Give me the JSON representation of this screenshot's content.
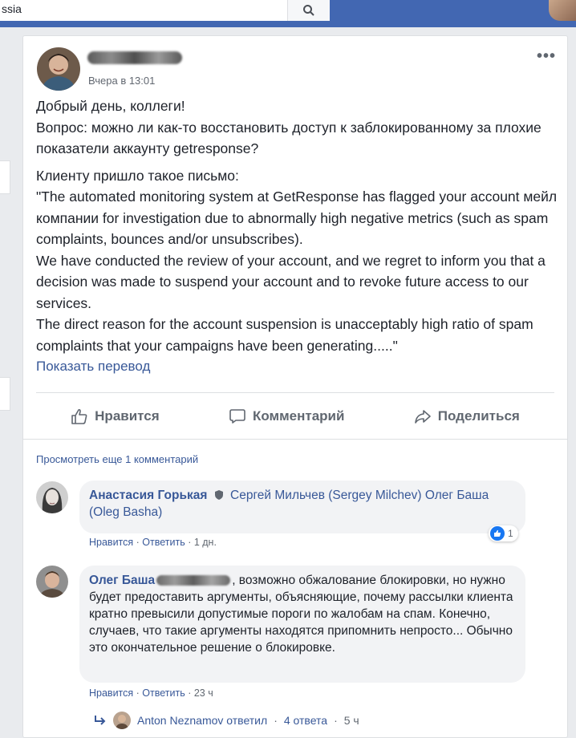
{
  "topbar": {
    "search_value": "ssia",
    "search_icon": "search-icon",
    "brand_color": "#4267b2"
  },
  "post": {
    "time": "Вчера в 13:01",
    "lines": [
      "Добрый день, коллеги!",
      "Вопрос: можно ли как-то восстановить доступ к заблокированному за плохие показатели аккаунту getresponse?"
    ],
    "paragraph2": [
      "Клиенту пришло такое письмо:",
      "\"The automated monitoring system at GetResponse has flagged your account мейл компании for investigation due to abnormally high negative metrics (such as spam complaints, bounces and/or unsubscribes).",
      "We have conducted the review of your account, and we regret to inform you that a decision was made to suspend your account and to revoke future access to our services.",
      "The direct reason for the account suspension is unacceptably high ratio of spam complaints that your campaigns have been generating.....\""
    ],
    "translate_link": "Показать перевод"
  },
  "actions": {
    "like": "Нравится",
    "comment": "Комментарий",
    "share": "Поделиться"
  },
  "comments": {
    "more_link": "Просмотреть еще 1 комментарий",
    "items": [
      {
        "author": "Анастасия Горькая",
        "text": "Сергей Мильчев (Sergey Milchev) Олег Баша (Oleg Basha)",
        "like": "Нравится",
        "reply": "Ответить",
        "age": "1 дн.",
        "reactions": "1"
      },
      {
        "author": "Олег Баша",
        "text": ", возможно обжалование блокировки, но нужно будет предоставить аргументы, объясняющие, почему рассылки клиента кратно превысили допустимые пороги по жалобам на спам. Конечно, случаев, что такие аргументы находятся припомнить непросто... Обычно это окончательное решение о блокировке.",
        "like": "Нравится",
        "reply": "Ответить",
        "age": "23 ч"
      }
    ],
    "reply_summary": {
      "author": "Anton Neznamov ответил",
      "count": "4 ответа",
      "age": "5 ч"
    }
  }
}
